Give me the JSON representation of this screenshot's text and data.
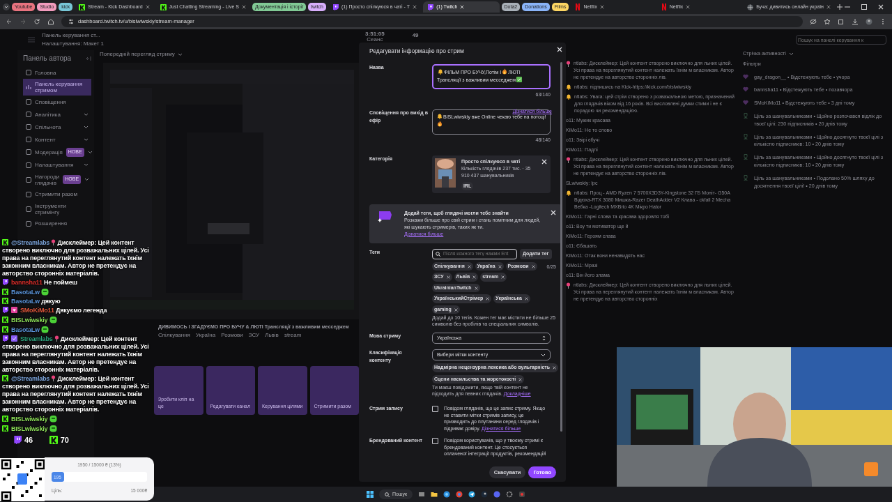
{
  "browser": {
    "tabs": [
      {
        "kind": "group",
        "label": "Youtube",
        "color": "#e8737f"
      },
      {
        "kind": "group",
        "label": "Studio",
        "color": "#f29bbd"
      },
      {
        "kind": "group",
        "label": "kick",
        "color": "#78c6d6"
      },
      {
        "kind": "kick",
        "label": "Stream - Kick Dashboard",
        "selected": false
      },
      {
        "kind": "kick",
        "label": "Just Chatting Streaming - Live S",
        "selected": false
      },
      {
        "kind": "group",
        "label": "Документація і історії",
        "color": "#81c995"
      },
      {
        "kind": "group",
        "label": "twitch",
        "color": "#d7aefb"
      },
      {
        "kind": "twitch",
        "label": "(1) Просто спілкуюся в чаті - T",
        "selected": false
      },
      {
        "kind": "twitch",
        "label": "(1) Twitch",
        "selected": true
      },
      {
        "kind": "group",
        "label": "Dota2",
        "color": "#a8b0b8"
      },
      {
        "kind": "group",
        "label": "Donations",
        "color": "#8ab4f8"
      },
      {
        "kind": "group",
        "label": "Films",
        "color": "#fdd663"
      },
      {
        "kind": "netflix",
        "label": "Netflix",
        "selected": false
      },
      {
        "kind": "netflix",
        "label": "Netflix",
        "selected": false
      },
      {
        "kind": "page",
        "label": "Буча: дивитись онлайн україн",
        "selected": false
      }
    ],
    "address": "dashboard.twitch.tv/u/bislwiwskiy/stream-manager"
  },
  "dashboard": {
    "header": {
      "title": "Панель керування ст...",
      "subtitle": "Налаштування: Макет 1",
      "session_time": "3:51:05",
      "session_label": "Сеанс",
      "viewers": "49",
      "search_placeholder": "Пошук на панелі керування к"
    },
    "sidebar": {
      "title": "Панель автора",
      "items": [
        {
          "label": "Головна",
          "selected": false,
          "has_submenu": false
        },
        {
          "label": "Панель керування стримом",
          "selected": true,
          "has_submenu": false
        },
        {
          "label": "Сповіщення",
          "selected": false,
          "has_submenu": false
        },
        {
          "label": "Аналітика",
          "selected": false,
          "has_submenu": true
        },
        {
          "label": "Спільнота",
          "selected": false,
          "has_submenu": true
        },
        {
          "label": "Контент",
          "selected": false,
          "has_submenu": true
        },
        {
          "label": "Модерація",
          "selected": false,
          "has_submenu": true,
          "badge": "НОВЕ"
        },
        {
          "label": "Налаштування",
          "selected": false,
          "has_submenu": true
        },
        {
          "label": "Нагороди глядачів",
          "selected": false,
          "has_submenu": true,
          "badge": "НОВЕ"
        },
        {
          "label": "Стримити разом",
          "selected": false,
          "has_submenu": false
        },
        {
          "label": "Інструменти стримінгу",
          "selected": false,
          "has_submenu": false
        },
        {
          "label": "Розширення",
          "selected": false,
          "has_submenu": false
        }
      ]
    },
    "preview": {
      "heading": "Попередній перегляд стриму",
      "stream_title": "ДИВИМОСЬ І ЗГАДУЄМО ПРО БУЧУ & ЛЮТІ Трансляції з важливим месседжем",
      "tags": [
        "Спілкування",
        "Україна",
        "Розмови",
        "ЗСУ",
        "Львів",
        "stream"
      ],
      "quick_actions": [
        "Зробити кліп на це",
        "Редагувати канал",
        "Керування цілями",
        "Стримити разом"
      ]
    },
    "chat": [
      {
        "kind": "pin",
        "text": "ntlabs: Дисклеймер: Цей контент створено виключно для льних цілей. Усі права на переглянутий контент належать їхнім м власникам. Автор не претендує на авторство сторонніх лів."
      },
      {
        "kind": "bell",
        "text": "ntlabs: підпишись на Kick-https://kick.com/bislwiwskiy"
      },
      {
        "kind": "bell",
        "text": "ntlabs: Увага: цей стрім створено з розважальною метою, призначений для глядачів віком від 16 років. Всі висловлені думки стими і не є порадою чи рекомендацією."
      },
      {
        "kind": "plain",
        "text": "o11: Мужик красава"
      },
      {
        "kind": "plain",
        "text": "KiMo11: Не то слово"
      },
      {
        "kind": "plain",
        "text": "o11: Звірі єбучі"
      },
      {
        "kind": "plain",
        "text": "KiMo11: Падлі"
      },
      {
        "kind": "pin",
        "text": "ntlabs: Дисклеймер: Цей контент створено виключно для льних цілей. Усі права на переглянутий контент належать їхнім м власникам. Автор не претендує на авторство сторонніх лів."
      },
      {
        "kind": "plain",
        "text": "SLwiwskiy: Іpc"
      },
      {
        "kind": "bell",
        "text": "ntlabs: Проц - AMD Ryzen 7 5700X3D3Y-Kingstone 32 ГБ Моніт- G50A Відюха-RTX 3080 Мишка-Razer DeathAdder V2 Клава - ckfall 2 Mecha Вебка -Logitech MXBrio 4K Мікро Hator"
      },
      {
        "kind": "plain",
        "text": "KiMo11: Гарні слова та красава здоровля тобі"
      },
      {
        "kind": "plain",
        "text": "o11: Воу ти мотиватор ще й"
      },
      {
        "kind": "plain",
        "text": "KiMo11: Героям слава"
      },
      {
        "kind": "plain",
        "text": "o11: Єбашать"
      },
      {
        "kind": "plain",
        "text": "KiMo11: Отак вони ненавидять нас"
      },
      {
        "kind": "plain",
        "text": "KiMo11: Мразі"
      },
      {
        "kind": "plain",
        "text": "o11: Він його злама"
      },
      {
        "kind": "pin",
        "text": "ntlabs: Дисклеймер: Цей контент створено виключно для льних цілей. Усі права на переглянутий контент належать їхнім м власникам. Автор не претендує на авторство сторонніх"
      }
    ],
    "activity": {
      "heading": "Стрічка активності",
      "filter": "Фільтри",
      "items": [
        {
          "kind": "follow",
          "text": "gay_dragon__ • Відстежують тебе • учора"
        },
        {
          "kind": "follow",
          "text": "bannsha11 • Відстежують тебе • позавчора"
        },
        {
          "kind": "follow",
          "text": "SMoKiMo11 • Відстежують тебе • 3 дні тому"
        },
        {
          "kind": "goal",
          "text": "Ціль за шанувальниками • Щойно розпочався відлік до твоєї цілі: 230 підписників • 20 днів тому"
        },
        {
          "kind": "goal",
          "text": "Ціль за шанувальниками • Щойно досягнуто твоєї цілі з кількістю підписників: 10 • 20 днів тому"
        },
        {
          "kind": "goal",
          "text": "Ціль за шанувальниками • Щойно досягнуто твоєї цілі з кількістю підписників: 10 • 20 днів тому"
        },
        {
          "kind": "goal",
          "text": "Ціль за шанувальниками • Подолано 50% шляху до досягнення твоєї цілі! • 20 днів тому"
        }
      ]
    }
  },
  "modal": {
    "title": "Редагувати інформацію про стрим",
    "name": {
      "label": "Назва",
      "segments": [
        {
          "kind": "bell"
        },
        {
          "kind": "text",
          "text": "ФІЛЬМ ПРО БУЧУ,Потім І"
        },
        {
          "kind": "flame"
        },
        {
          "kind": "text",
          "text": "ЛЮТІ Трансляції з важливим месседжем"
        },
        {
          "kind": "check"
        }
      ],
      "counter": "63/140",
      "focused": true
    },
    "notification": {
      "label": "Сповіщення про вихід в ефір",
      "link": "Дізнатися більше",
      "segments": [
        {
          "kind": "bell"
        },
        {
          "kind": "text",
          "text": "BISLwiwskiy вже Online чекаю тебе на потоці!"
        },
        {
          "kind": "flame"
        }
      ],
      "counter": "48/140",
      "focused": false
    },
    "category": {
      "label": "Категорія",
      "name": "Просто спілкуюся в чаті",
      "stats": "Кількість глядачів 237 тис. · 35 910 437 шанувальників",
      "tag": "IRL"
    },
    "tip": {
      "title": "Додай теги, щоб глядачі могли тебе знайти",
      "text": "Розкажи більше про свій стрим і стань помітним для людей, які шукають стримерів, таких як ти.",
      "link": "Дізнатися більше"
    },
    "tags": {
      "label": "Теги",
      "placeholder": "Після кожного тегу нажми Ent",
      "button": "Додати тег",
      "counter": "0/25",
      "items": [
        "Спілкування",
        "Україна",
        "Розмови",
        "ЗСУ",
        "Львів",
        "stream",
        "UkrainianTwitch",
        "УкраїнськийСтрімер",
        "Українська",
        "gaming"
      ],
      "hint": "Додай до 10 тегів. Кожен тег має містити не більше 25 символів без пробілів та спеціальних символів."
    },
    "language": {
      "label": "Мова стриму",
      "value": "Українська"
    },
    "classification": {
      "label": "Класифікація контенту",
      "placeholder": "Вибери мітки контенту",
      "items": [
        "Надмірна нецензурна лексика або вульгарність",
        "Сцени насильства та жорстокості"
      ],
      "hint": "Ти маєш повідомити, якщо твій контент не підходить для певних глядачів.",
      "link": "Докладніше"
    },
    "rerun": {
      "label": "Стрим запису",
      "checked": false,
      "text": "Повідом глядачів, що це запис стриму. Якщо не ставити мітки стримів запису, це призводить до плутанини серед глядачів і підриває довіру.",
      "link": "Дізнатися більше"
    },
    "branded": {
      "label": "Брендований контент",
      "checked": false,
      "text": "Повідом користувачів, що у твоєму стримі є брендований контент. Це стосується оплаченої інтеграції продуктів, рекомендацій"
    },
    "buttons": {
      "cancel": "Скасувати",
      "done": "Готово"
    }
  },
  "overlay": {
    "messages": [
      {
        "kick": true,
        "subscriber": false,
        "verified": false,
        "user": "@Streamlabs",
        "color": "#7fa8e0",
        "kind": "notice",
        "text": "Дисклеймер: Цей контент створено виключно для розважальних цілей. Усі права на переглянутий контент належать їхнім законним власникам. Автор не претендує на авторство сторонніх матеріалів."
      },
      {
        "kick": false,
        "subscriber": false,
        "verified": false,
        "user": "bannsha11",
        "color": "#e0302c",
        "kind": "text",
        "text": "Не поймеш"
      },
      {
        "kick": true,
        "subscriber": false,
        "verified": false,
        "user": "BasotaLw",
        "color": "#5b93d8",
        "kind": "emote"
      },
      {
        "kick": true,
        "subscriber": false,
        "verified": false,
        "user": "BasotaLw",
        "color": "#5b93d8",
        "kind": "text",
        "text": "дякую"
      },
      {
        "kick": false,
        "subscriber": true,
        "verified": false,
        "user": "SMoKiMo11",
        "color": "#e2583e",
        "kind": "text",
        "text": "Дякуємо легенда"
      },
      {
        "kick": true,
        "subscriber": false,
        "verified": false,
        "user": "BISLwiwskiy",
        "color": "#8ee05a",
        "kind": "emote"
      },
      {
        "kick": true,
        "subscriber": false,
        "verified": false,
        "user": "BasotaLw",
        "color": "#5b93d8",
        "kind": "emote"
      },
      {
        "kick": false,
        "subscriber": false,
        "verified": true,
        "user": "Streamlabs",
        "color": "#2fa57f",
        "kind": "notice",
        "text": "Дисклеймер: Цей контент створено виключно для розважальних цілей. Усі права на переглянутий контент належать їхнім законним власникам. Автор не претендує на авторство сторонніх матеріалів."
      },
      {
        "kick": true,
        "subscriber": false,
        "verified": false,
        "user": "@Streamlabs",
        "color": "#7fa8e0",
        "kind": "notice",
        "text": "Дисклеймер: Цей контент створено виключно для розважальних цілей. Усі права на переглянутий контент належать їхнім законним власникам. Автор не претендує на авторство сторонніх матеріалів."
      },
      {
        "kick": true,
        "subscriber": false,
        "verified": false,
        "user": "BISLwiwskiy",
        "color": "#8ee05a",
        "kind": "emote"
      },
      {
        "kick": true,
        "subscriber": false,
        "verified": false,
        "user": "BISLwiwskiy",
        "color": "#8ee05a",
        "kind": "emote"
      }
    ],
    "viewers": [
      {
        "kick": false,
        "count": "46"
      },
      {
        "kick": true,
        "count": "70"
      }
    ],
    "goal": {
      "summary": "1950 / 15000 ₴ (13%)",
      "level": 0.13,
      "bar_label": "195",
      "target_label": "Ціль:",
      "target": "15 000₴"
    }
  },
  "taskbar": {
    "search": "Пошук"
  }
}
